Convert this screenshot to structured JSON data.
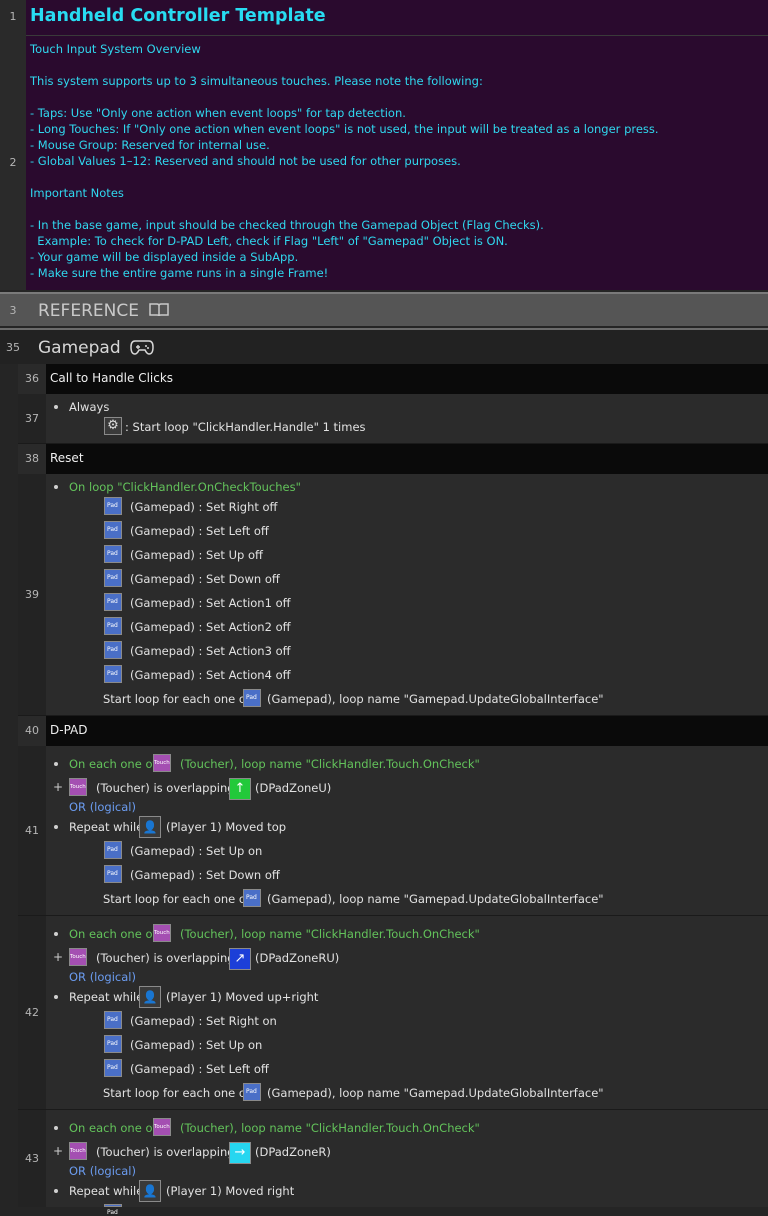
{
  "comment1": {
    "line": "1",
    "title": "Handheld Controller Template"
  },
  "comment2": {
    "line": "2",
    "lines": [
      "Touch Input System Overview",
      "This system supports up to 3 simultaneous touches. Please note the following:",
      "- Taps: Use \"Only one action when event loops\" for tap detection.",
      "- Long Touches: If \"Only one action when event loops\" is not used, the input will be treated as a longer press.",
      "- Mouse Group: Reserved for internal use.",
      "- Global Values 1–12: Reserved and should not be used for other purposes.",
      "Important Notes",
      "- In the base game, input should be checked through the Gamepad Object (Flag Checks).",
      "  Example: To check for D-PAD Left, check if Flag \"Left\" of \"Gamepad\" Object is ON.",
      "- Your game will be displayed inside a SubApp.",
      "- Make sure the entire game runs in a single Frame!"
    ]
  },
  "groups": {
    "reference": {
      "line": "3",
      "name": "REFERENCE",
      "icon": "book-icon"
    },
    "gamepad": {
      "line": "35",
      "name": "Gamepad",
      "icon": "gamepad-icon"
    }
  },
  "sections": {
    "s36": {
      "line": "36",
      "name": "Call to Handle Clicks"
    },
    "s38": {
      "line": "38",
      "name": "Reset"
    },
    "s40": {
      "line": "40",
      "name": "D-PAD"
    }
  },
  "events": {
    "e37": {
      "line": "37",
      "condition": "Always",
      "action": ": Start loop \"ClickHandler.Handle\" 1 times"
    },
    "e39": {
      "line": "39",
      "condition": "On loop \"ClickHandler.OnCheckTouches\"",
      "actions": [
        "(Gamepad) : Set Right off",
        "(Gamepad) : Set Left off",
        "(Gamepad) : Set Up off",
        "(Gamepad) : Set Down off",
        "(Gamepad) : Set Action1 off",
        "(Gamepad) : Set Action2 off",
        "(Gamepad) : Set Action3 off",
        "(Gamepad) : Set Action4 off"
      ],
      "loop_prefix": "Start loop for each one of",
      "loop_suffix": "(Gamepad), loop name \"Gamepad.UpdateGlobalInterface\""
    },
    "e41": {
      "line": "41",
      "on_prefix": "On each one of",
      "on_suffix": "(Toucher), loop name \"ClickHandler.Touch.OnCheck\"",
      "overlap_a": "(Toucher) is overlapping",
      "overlap_b": "(DPadZoneU)",
      "or": "OR (logical)",
      "repeat_a": "Repeat while",
      "repeat_b": "(Player 1) Moved top",
      "actions": [
        "(Gamepad) : Set Up on",
        "(Gamepad) : Set Down off"
      ],
      "loop_prefix": "Start loop for each one of",
      "loop_suffix": "(Gamepad), loop name \"Gamepad.UpdateGlobalInterface\""
    },
    "e42": {
      "line": "42",
      "on_prefix": "On each one of",
      "on_suffix": "(Toucher), loop name \"ClickHandler.Touch.OnCheck\"",
      "overlap_a": "(Toucher) is overlapping",
      "overlap_b": "(DPadZoneRU)",
      "or": "OR (logical)",
      "repeat_a": "Repeat while",
      "repeat_b": "(Player 1) Moved up+right",
      "actions": [
        "(Gamepad) : Set Right on",
        "(Gamepad) : Set Up on",
        "(Gamepad) : Set Left off"
      ],
      "loop_prefix": "Start loop for each one of",
      "loop_suffix": "(Gamepad), loop name \"Gamepad.UpdateGlobalInterface\""
    },
    "e43": {
      "line": "43",
      "on_prefix": "On each one of",
      "on_suffix": "(Toucher), loop name \"ClickHandler.Touch.OnCheck\"",
      "overlap_a": "(Toucher) is overlapping",
      "overlap_b": "(DPadZoneR)",
      "or": "OR (logical)",
      "repeat_a": "Repeat while",
      "repeat_b": "(Player 1) Moved right"
    }
  }
}
